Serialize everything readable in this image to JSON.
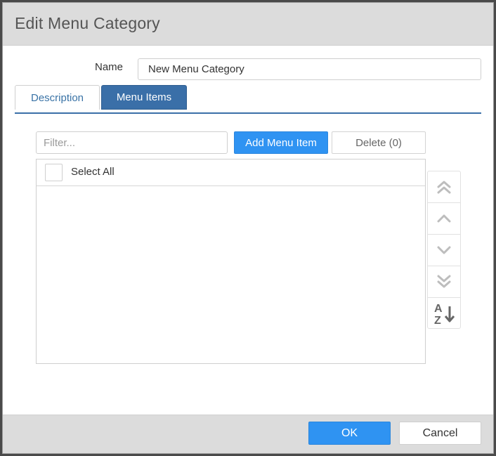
{
  "dialog": {
    "title": "Edit Menu Category"
  },
  "name_field": {
    "label": "Name",
    "value": "New Menu Category"
  },
  "tabs": [
    {
      "label": "Description",
      "active": false
    },
    {
      "label": "Menu Items",
      "active": true
    }
  ],
  "toolbar": {
    "filter_placeholder": "Filter...",
    "add_label": "Add Menu Item",
    "delete_label": "Delete (0)"
  },
  "list": {
    "select_all_label": "Select All",
    "items": []
  },
  "side_tools": [
    {
      "icon": "move-to-top-icon"
    },
    {
      "icon": "move-up-icon"
    },
    {
      "icon": "move-down-icon"
    },
    {
      "icon": "move-to-bottom-icon"
    },
    {
      "icon": "sort-az-icon",
      "glyph_top": "A",
      "glyph_bottom": "Z"
    }
  ],
  "footer": {
    "ok_label": "OK",
    "cancel_label": "Cancel"
  },
  "colors": {
    "accent": "#2f93f2",
    "tab_active": "#3a6fa8",
    "titlebar": "#dcdcdc"
  }
}
